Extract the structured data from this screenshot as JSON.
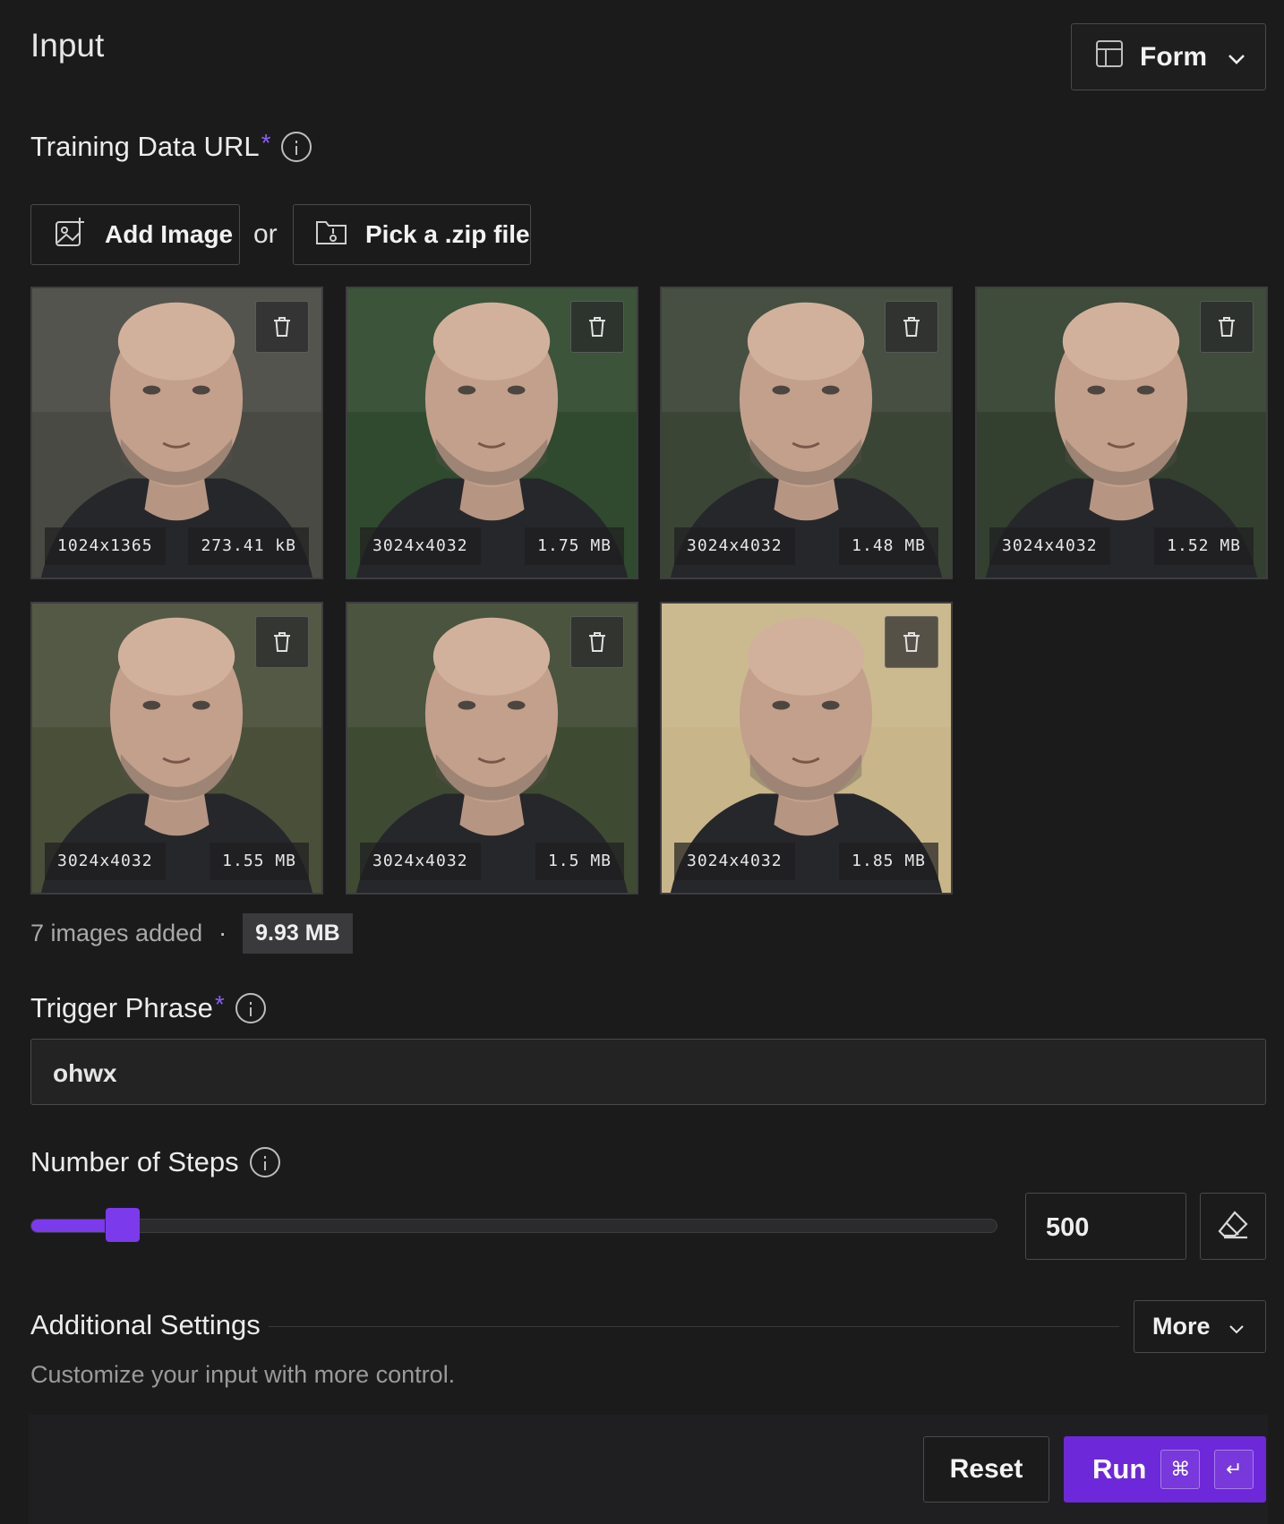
{
  "header": {
    "title": "Input",
    "view_select": {
      "label": "Form"
    }
  },
  "training": {
    "label": "Training Data URL",
    "required_mark": "*",
    "add_image_label": "Add Image",
    "or_label": "or",
    "zip_label": "Pick a .zip file",
    "images": [
      {
        "dims": "1024x1365",
        "size": "273.41 kB",
        "bg": "#4a4a44"
      },
      {
        "dims": "3024x4032",
        "size": "1.75 MB",
        "bg": "#2f4a2e"
      },
      {
        "dims": "3024x4032",
        "size": "1.48 MB",
        "bg": "#3b4536"
      },
      {
        "dims": "3024x4032",
        "size": "1.52 MB",
        "bg": "#33402f"
      },
      {
        "dims": "3024x4032",
        "size": "1.55 MB",
        "bg": "#4a4f3a"
      },
      {
        "dims": "3024x4032",
        "size": "1.5 MB",
        "bg": "#3f4a33"
      },
      {
        "dims": "3024x4032",
        "size": "1.85 MB",
        "bg": "#c8b68a"
      }
    ],
    "summary_count": "7 images added",
    "summary_sep": "·",
    "summary_size": "9.93 MB"
  },
  "trigger": {
    "label": "Trigger Phrase",
    "required_mark": "*",
    "value": "ohwx"
  },
  "steps": {
    "label": "Number of Steps",
    "value": "500",
    "slider_fraction": 0.065
  },
  "additional": {
    "label": "Additional Settings",
    "more_label": "More",
    "hint": "Customize your input with more control."
  },
  "footer": {
    "reset_label": "Reset",
    "run_label": "Run",
    "kbd_cmd": "⌘",
    "kbd_enter": "↵"
  },
  "colors": {
    "accent": "#7c3aed",
    "run": "#6d28d9"
  }
}
